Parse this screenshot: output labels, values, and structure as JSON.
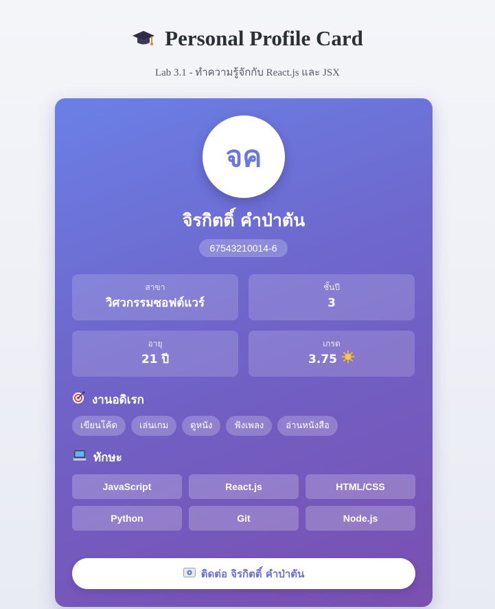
{
  "header": {
    "title": "Personal Profile Card",
    "title_icon": "graduation-cap-icon",
    "subtitle": "Lab 3.1 - ทำความรู้จักกับ React.js และ JSX"
  },
  "profile": {
    "avatar_initials": "จค",
    "name": "จิรกิตติ์ คำป่าตัน",
    "student_id": "67543210014-6"
  },
  "info": {
    "major": {
      "label": "สาขา",
      "value": "วิศวกรรมซอฟต์แวร์"
    },
    "year": {
      "label": "ชั้นปี",
      "value": "3"
    },
    "age": {
      "label": "อายุ",
      "value": "21 ปี"
    },
    "gpa": {
      "label": "เกรด",
      "value": "3.75",
      "icon": "sun-icon"
    }
  },
  "hobbies": {
    "title": "งานอดิเรก",
    "icon": "target-icon",
    "items": [
      "เขียนโค้ด",
      "เล่นเกม",
      "ดูหนัง",
      "ฟังเพลง",
      "อ่านหนังสือ"
    ]
  },
  "skills": {
    "title": "ทักษะ",
    "icon": "laptop-icon",
    "items": [
      "JavaScript",
      "React.js",
      "HTML/CSS",
      "Python",
      "Git",
      "Node.js"
    ]
  },
  "contact": {
    "label": "ติดต่อ จิรกิตติ์ คำป่าตัน",
    "icon": "contact-card-icon"
  },
  "colors": {
    "card_gradient_start": "#6a80e6",
    "card_gradient_end": "#7a4fb0",
    "accent_text": "#6a79dc"
  }
}
